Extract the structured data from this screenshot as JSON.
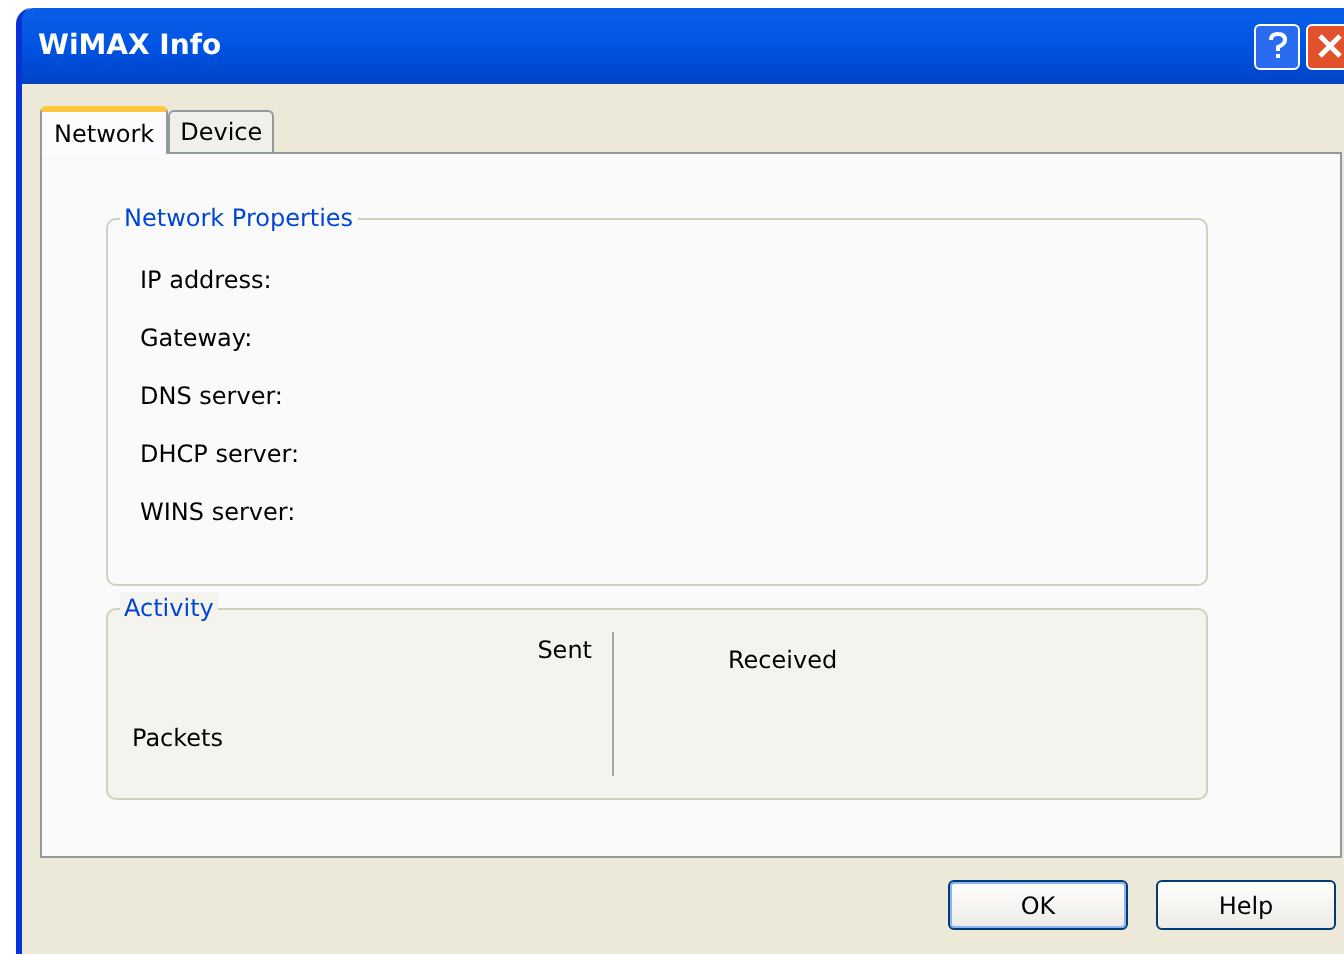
{
  "window": {
    "title": "WiMAX Info"
  },
  "tabs": [
    {
      "label": "Network",
      "selected": true
    },
    {
      "label": "Device",
      "selected": false
    }
  ],
  "network_properties": {
    "title": "Network Properties",
    "fields": [
      "IP address:",
      "Gateway:",
      "DNS server:",
      "DHCP server:",
      "WINS server:"
    ]
  },
  "activity": {
    "title": "Activity",
    "column_sent": "Sent",
    "column_received": "Received",
    "row_label": "Packets"
  },
  "buttons": [
    "OK",
    "Help"
  ]
}
